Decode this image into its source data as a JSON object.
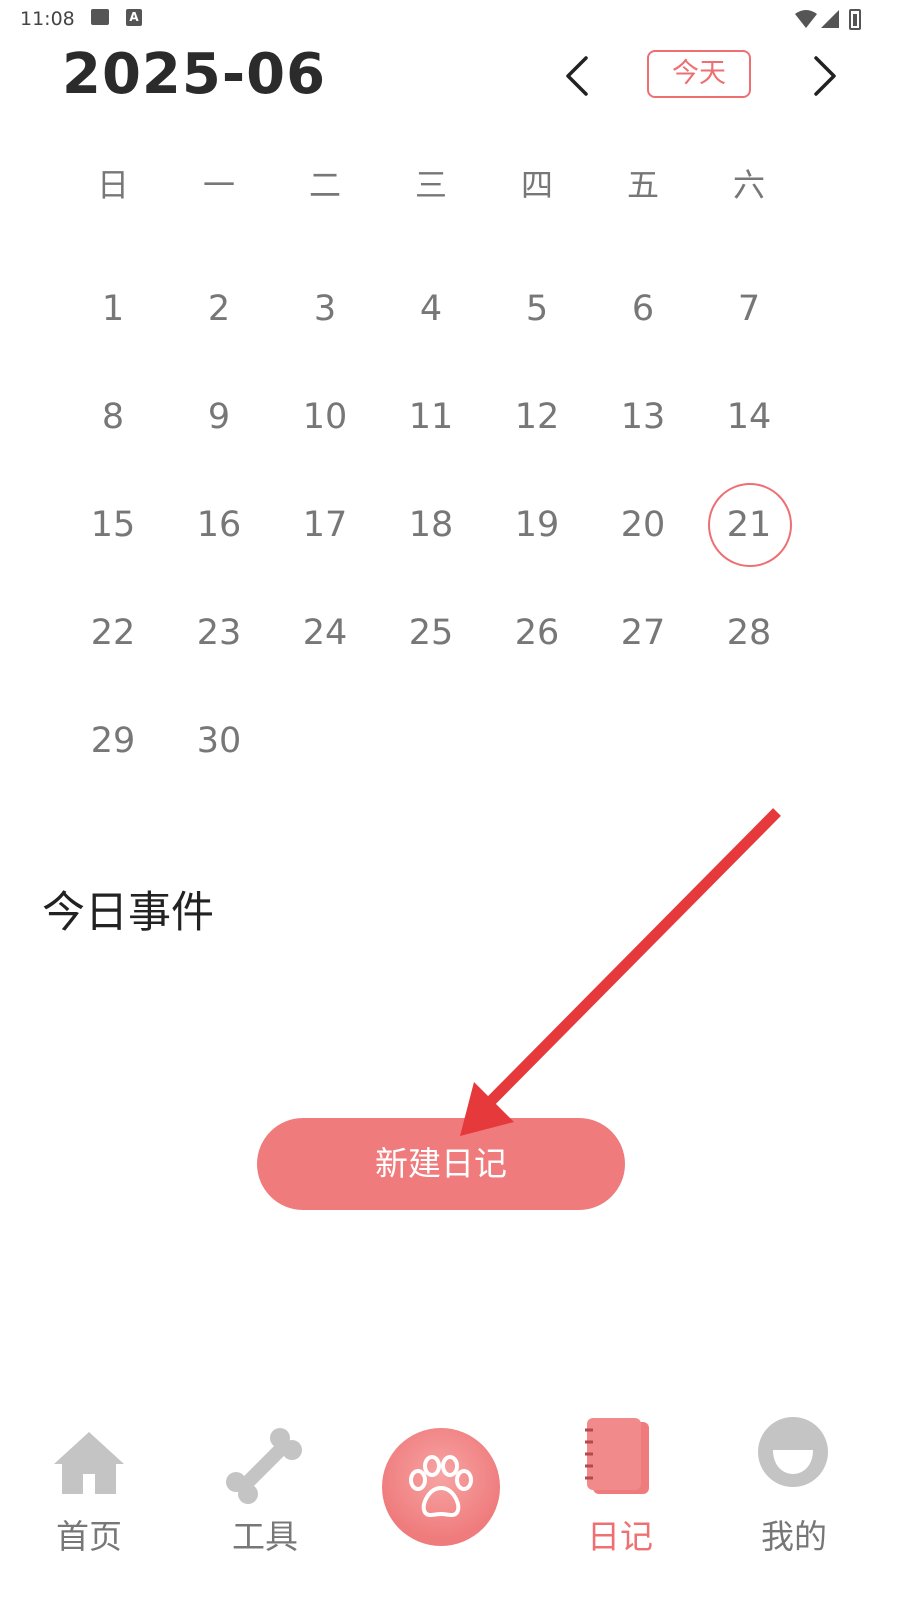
{
  "status_bar": {
    "time": "11:08"
  },
  "header": {
    "month": "2025-06",
    "today_button": "今天"
  },
  "calendar": {
    "weekdays": [
      "日",
      "一",
      "二",
      "三",
      "四",
      "五",
      "六"
    ],
    "days": [
      "1",
      "2",
      "3",
      "4",
      "5",
      "6",
      "7",
      "8",
      "9",
      "10",
      "11",
      "12",
      "13",
      "14",
      "15",
      "16",
      "17",
      "18",
      "19",
      "20",
      "21",
      "22",
      "23",
      "24",
      "25",
      "26",
      "27",
      "28",
      "29",
      "30"
    ],
    "first_weekday_index": 0,
    "selected_day": "21"
  },
  "events": {
    "title": "今日事件",
    "new_button": "新建日记"
  },
  "colors": {
    "accent": "#ef7072",
    "arrow": "#e5393c",
    "inactive": "#c4c4c4"
  },
  "bottom_nav": {
    "items": [
      {
        "label": "首页",
        "icon": "home-icon"
      },
      {
        "label": "工具",
        "icon": "bone-icon"
      },
      {
        "label": "",
        "icon": "paw-icon"
      },
      {
        "label": "日记",
        "icon": "diary-icon",
        "active": true
      },
      {
        "label": "我的",
        "icon": "profile-icon"
      }
    ]
  }
}
